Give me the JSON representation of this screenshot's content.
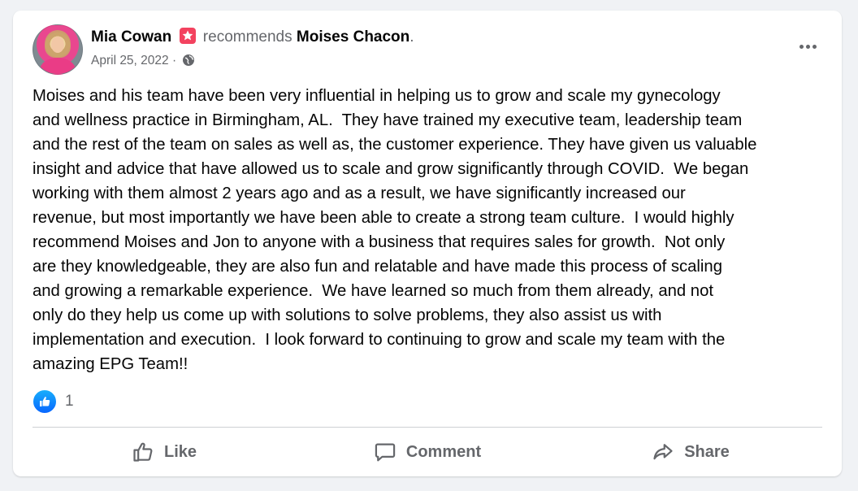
{
  "post": {
    "author": "Mia Cowan",
    "recommends_text": "recommends",
    "recommended_page": "Moises Chacon",
    "trailing_punct": ".",
    "date": "April 25, 2022",
    "separator": "·",
    "audience_icon": "globe-icon",
    "badge_icon": "star-badge-icon",
    "body": "Moises and his team have been very influential in helping us to grow and scale my gynecology\nand wellness practice in Birmingham, AL.  They have trained my executive team, leadership team\nand the rest of the team on sales as well as, the customer experience. They have given us valuable\ninsight and advice that have allowed us to scale and grow significantly through COVID.  We began\nworking with them almost 2 years ago and as a result, we have significantly increased our\nrevenue, but most importantly we have been able to create a strong team culture.  I would highly\nrecommend Moises and Jon to anyone with a business that requires sales for growth.  Not only\nare they knowledgeable, they are also fun and relatable and have made this process of scaling\nand growing a remarkable experience.  We have learned so much from them already, and not\nonly do they help us come up with solutions to solve problems, they also assist us with\nimplementation and execution.  I look forward to continuing to grow and scale my team with the\namazing EPG Team!!",
    "reaction_count": "1"
  },
  "actions": {
    "like": "Like",
    "comment": "Comment",
    "share": "Share"
  },
  "colors": {
    "badge": "#f3425f",
    "like_blue": "#0866ff",
    "muted": "#65676b"
  }
}
